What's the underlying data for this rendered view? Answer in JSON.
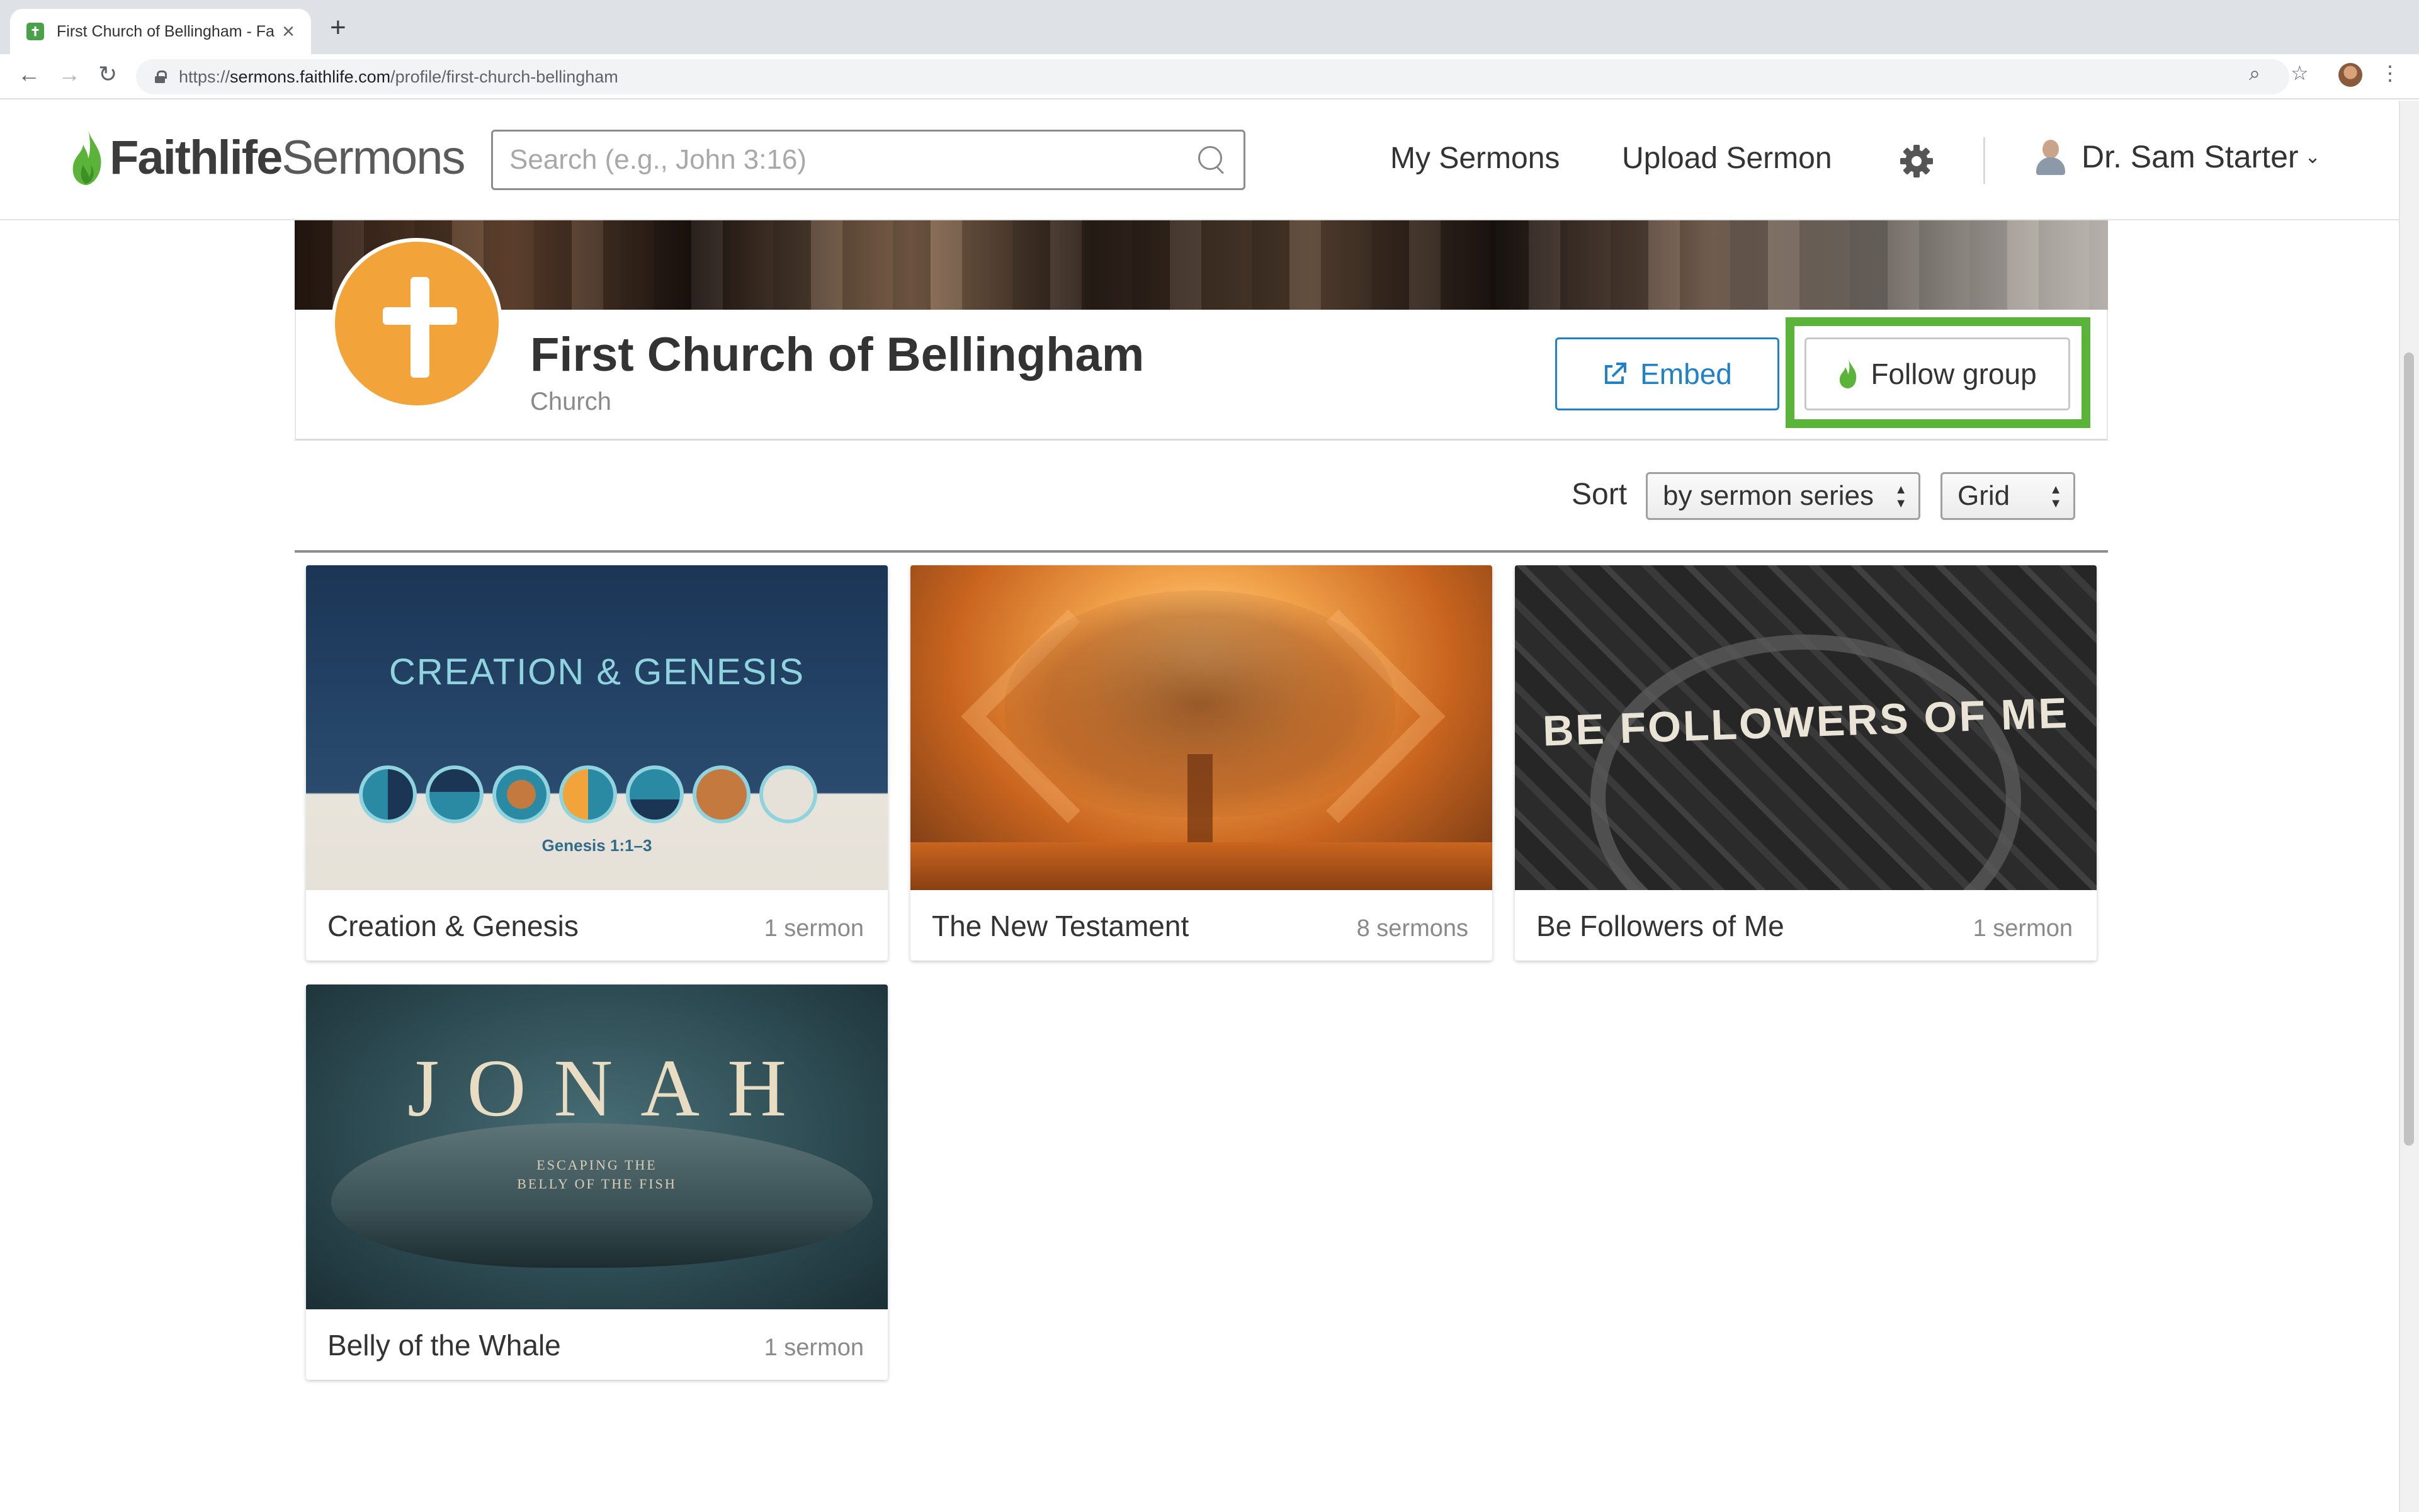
{
  "browser": {
    "tab_title": "First Church of Bellingham - Fa",
    "tab_favicon": "faithlife-favicon",
    "url_prefix": "https://",
    "url_host": "sermons.faithlife.com",
    "url_path": "/profile/first-church-bellingham",
    "new_tab_glyph": "+",
    "close_glyph": "×"
  },
  "header": {
    "logo_bold": "Faithlife",
    "logo_light": "Sermons",
    "search_placeholder": "Search (e.g., John 3:16)",
    "nav": {
      "my_sermons": "My Sermons",
      "upload_sermon": "Upload Sermon"
    },
    "user_name": "Dr. Sam Starter"
  },
  "profile": {
    "name": "First Church of Bellingham",
    "type": "Church",
    "embed_label": "Embed",
    "follow_label": "Follow group"
  },
  "controls": {
    "sort_label": "Sort",
    "sort_value": "by sermon series",
    "view_value": "Grid"
  },
  "series": [
    {
      "title": "Creation & Genesis",
      "count": "1 sermon",
      "art_title": "CREATION & GENESIS",
      "art_subtitle": "Genesis 1:1–3"
    },
    {
      "title": "The New Testament",
      "count": "8 sermons"
    },
    {
      "title": "Be Followers of Me",
      "count": "1 sermon",
      "art_title": "BE FOLLOWERS OF ME"
    },
    {
      "title": "Belly of the Whale",
      "count": "1 sermon",
      "art_title": "JONAH",
      "art_subtitle_1": "ESCAPING THE",
      "art_subtitle_2": "BELLY OF THE FISH"
    }
  ],
  "colors": {
    "brand_green": "#5bb33a",
    "link_blue": "#1f82c8",
    "church_orange": "#f2a43a"
  }
}
